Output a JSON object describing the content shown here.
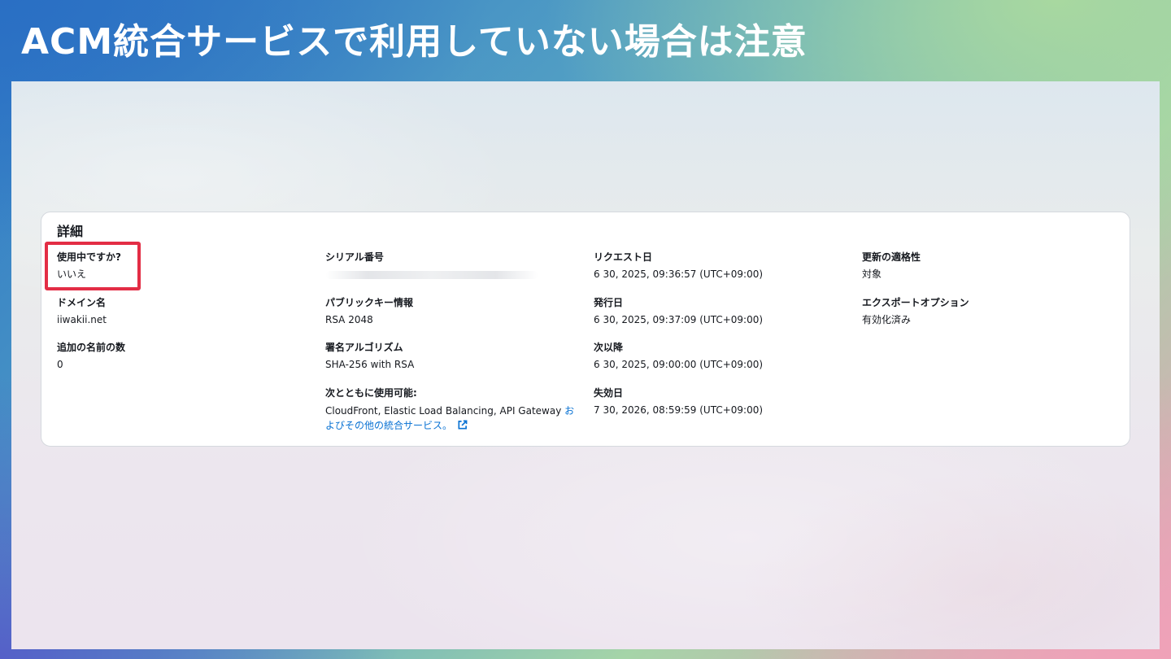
{
  "slide": {
    "title": "ACM統合サービスで利用していない場合は注意"
  },
  "details": {
    "heading": "詳細",
    "fields": {
      "in_use": {
        "label": "使用中ですか?",
        "value": "いいえ"
      },
      "domain_name": {
        "label": "ドメイン名",
        "value": "iiwakii.net"
      },
      "additional_names": {
        "label": "追加の名前の数",
        "value": "0"
      },
      "serial_number": {
        "label": "シリアル番号",
        "value": ""
      },
      "public_key": {
        "label": "パブリックキー情報",
        "value": "RSA 2048"
      },
      "signature_algorithm": {
        "label": "署名アルゴリズム",
        "value": "SHA-256 with RSA"
      },
      "usable_with": {
        "label": "次とともに使用可能:",
        "value_text": "CloudFront, Elastic Load Balancing, API Gateway ",
        "value_link": "およびその他の統合サービス。"
      },
      "requested_at": {
        "label": "リクエスト日",
        "value": "6 30, 2025, 09:36:57 (UTC+09:00)"
      },
      "issued_at": {
        "label": "発行日",
        "value": "6 30, 2025, 09:37:09 (UTC+09:00)"
      },
      "not_before": {
        "label": "次以降",
        "value": "6 30, 2025, 09:00:00 (UTC+09:00)"
      },
      "expires_at": {
        "label": "失効日",
        "value": "7 30, 2026, 08:59:59 (UTC+09:00)"
      },
      "renewal_eligibility": {
        "label": "更新の適格性",
        "value": "対象"
      },
      "export_option": {
        "label": "エクスポートオプション",
        "value": "有効化済み"
      }
    },
    "icons": {
      "external_link": "external-link-icon"
    }
  },
  "colors": {
    "highlight": "#e32d45",
    "link": "#0972d3",
    "text": "#16191f"
  }
}
